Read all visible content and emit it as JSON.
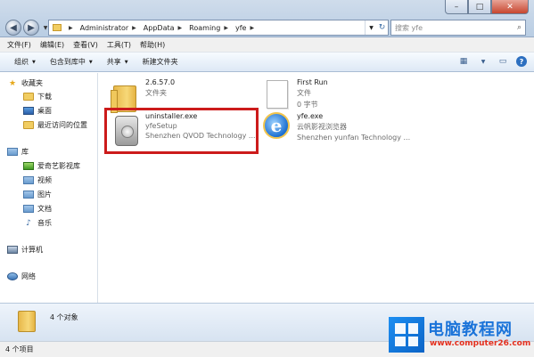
{
  "window": {
    "min_label": "–",
    "max_label": "□",
    "close_label": "✕"
  },
  "address": {
    "crumbs": [
      "Administrator",
      "AppData",
      "Roaming",
      "yfe"
    ],
    "search_placeholder": "搜索 yfe"
  },
  "menu": [
    "文件(F)",
    "编辑(E)",
    "查看(V)",
    "工具(T)",
    "帮助(H)"
  ],
  "toolbar": {
    "organize": "组织",
    "include_library": "包含到库中",
    "share": "共享",
    "new_folder": "新建文件夹"
  },
  "nav": {
    "favorites": "收藏夹",
    "downloads": "下载",
    "desktop": "桌面",
    "recent": "最近访问的位置",
    "libraries": "库",
    "iqiyi": "爱奇艺影视库",
    "videos": "视频",
    "pictures": "图片",
    "documents": "文档",
    "music": "音乐",
    "computer": "计算机",
    "network": "网络"
  },
  "files": [
    {
      "name": "2.6.57.0",
      "line2": "文件夹",
      "line3": ""
    },
    {
      "name": "First Run",
      "line2": "文件",
      "line3": "0 字节"
    },
    {
      "name": "uninstaller.exe",
      "line2": "yfeSetup",
      "line3": "Shenzhen QVOD Technology ..."
    },
    {
      "name": "yfe.exe",
      "line2": "云帆影视浏览器",
      "line3": "Shenzhen yunfan Technology ..."
    }
  ],
  "details": {
    "count": "4 个对象"
  },
  "status": {
    "items": "4 个项目"
  },
  "watermark": {
    "title": "电脑教程网",
    "url": "www.computer26.com"
  },
  "colors": {
    "highlight": "#cc1b1b",
    "accent": "#1a73d9"
  }
}
